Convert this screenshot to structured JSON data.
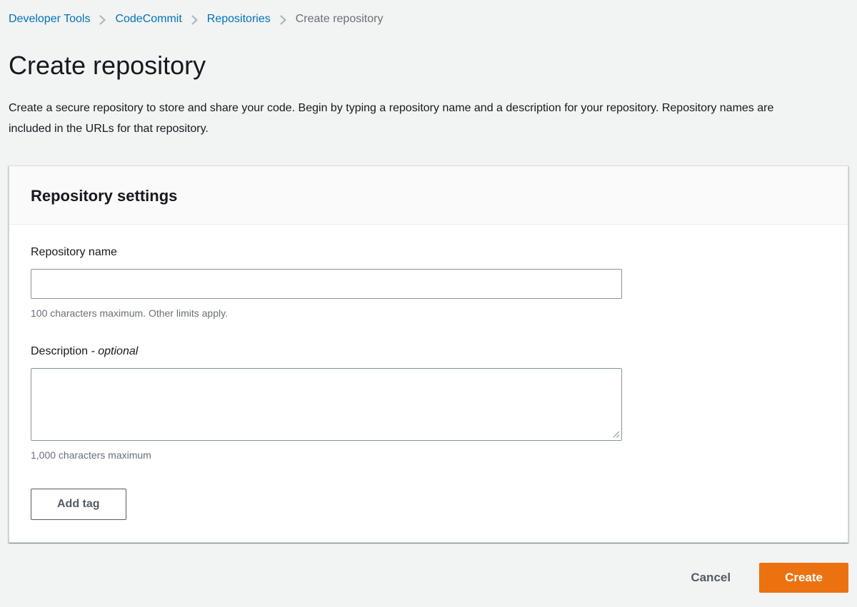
{
  "breadcrumb": {
    "items": [
      {
        "label": "Developer Tools"
      },
      {
        "label": "CodeCommit"
      },
      {
        "label": "Repositories"
      },
      {
        "label": "Create repository"
      }
    ],
    "separator_icon": "chevron-right"
  },
  "page": {
    "title": "Create repository",
    "description": "Create a secure repository to store and share your code. Begin by typing a repository name and a description for your repository. Repository names are included in the URLs for that repository."
  },
  "form": {
    "section_title": "Repository settings",
    "repository_name": {
      "label": "Repository name",
      "value": "",
      "helper": "100 characters maximum. Other limits apply."
    },
    "description": {
      "label": "Description",
      "label_suffix": "- optional",
      "value": "",
      "helper": "1,000 characters maximum"
    },
    "add_tag_label": "Add tag"
  },
  "actions": {
    "cancel_label": "Cancel",
    "create_label": "Create"
  },
  "colors": {
    "page_background": "#f2f3f3",
    "link_blue": "#0073bb",
    "breadcrumb_separator_gray": "#aab7b8",
    "text_dark": "#16191f",
    "helper_gray": "#687078",
    "input_border_gray": "#879596",
    "secondary_button_gray": "#545b64",
    "accent_orange": "#ec7211"
  },
  "icons": {
    "breadcrumb_separator": "chevron-right-icon",
    "textarea_resize": "resize-handle-icon"
  }
}
